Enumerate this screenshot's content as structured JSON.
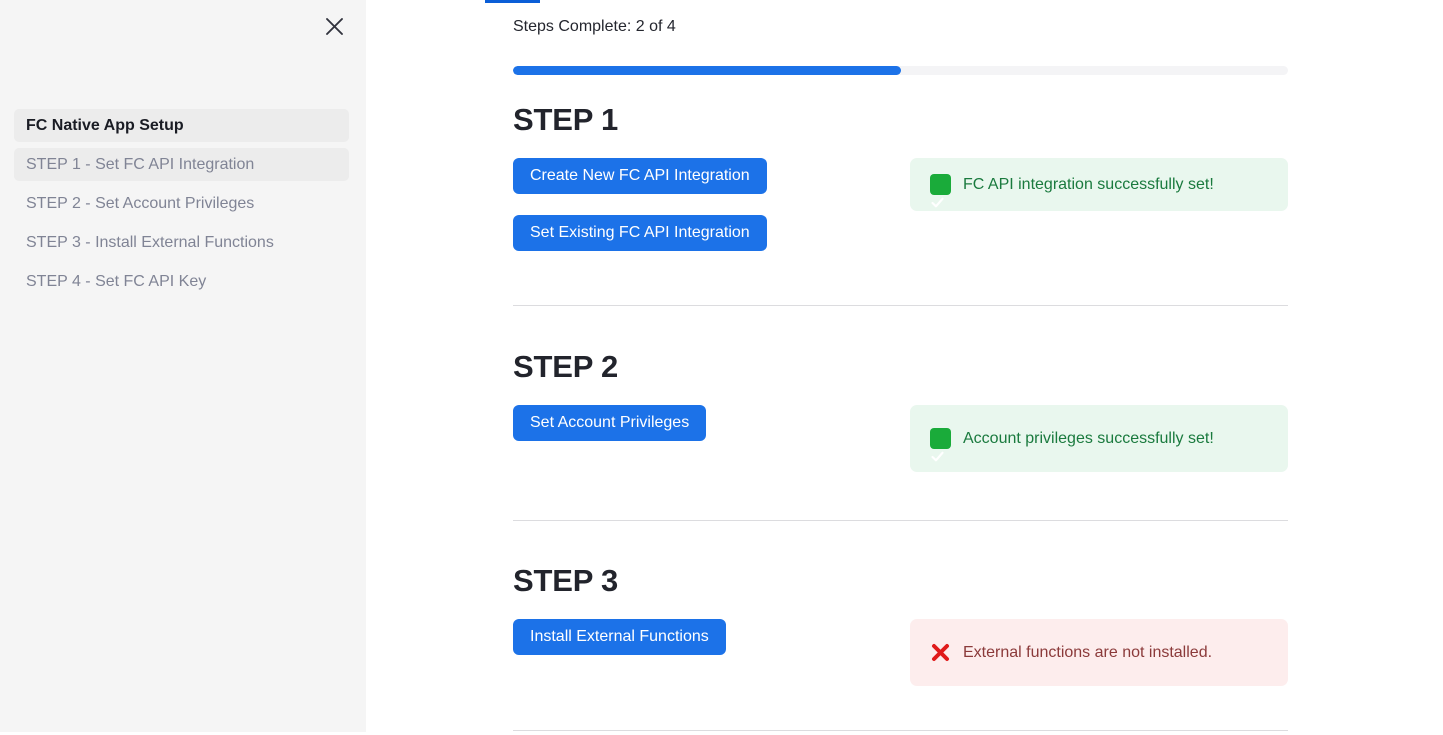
{
  "sidebar": {
    "close_icon": "close-icon",
    "title": "FC Native App Setup",
    "items": [
      {
        "label": "STEP 1 - Set FC API Integration",
        "active": true
      },
      {
        "label": "STEP 2 - Set Account Privileges",
        "active": false
      },
      {
        "label": "STEP 3 - Install External Functions",
        "active": false
      },
      {
        "label": "STEP 4 - Set FC API Key",
        "active": false
      }
    ]
  },
  "main": {
    "progress_label": "Steps Complete: 2 of 4",
    "progress_percent": 50,
    "accent_color": "#1c72e8",
    "tab_indicator_color": "#0b5ed7",
    "sections": [
      {
        "heading": "STEP 1",
        "buttons": [
          "Create New FC API Integration",
          "Set Existing FC API Integration"
        ],
        "status": {
          "type": "success",
          "icon": "white-heavy-check-mark-icon",
          "text": "FC API integration successfully set!",
          "bg": "#e9f7ee",
          "color": "#1a7a3e"
        }
      },
      {
        "heading": "STEP 2",
        "buttons": [
          "Set Account Privileges"
        ],
        "status": {
          "type": "success",
          "icon": "white-heavy-check-mark-icon",
          "text": "Account privileges successfully set!",
          "bg": "#e9f7ee",
          "color": "#1a7a3e"
        }
      },
      {
        "heading": "STEP 3",
        "buttons": [
          "Install External Functions"
        ],
        "status": {
          "type": "error",
          "icon": "cross-mark-icon",
          "text": "External functions are not installed.",
          "bg": "#fdeded",
          "color": "#8b3a3a"
        }
      }
    ]
  }
}
